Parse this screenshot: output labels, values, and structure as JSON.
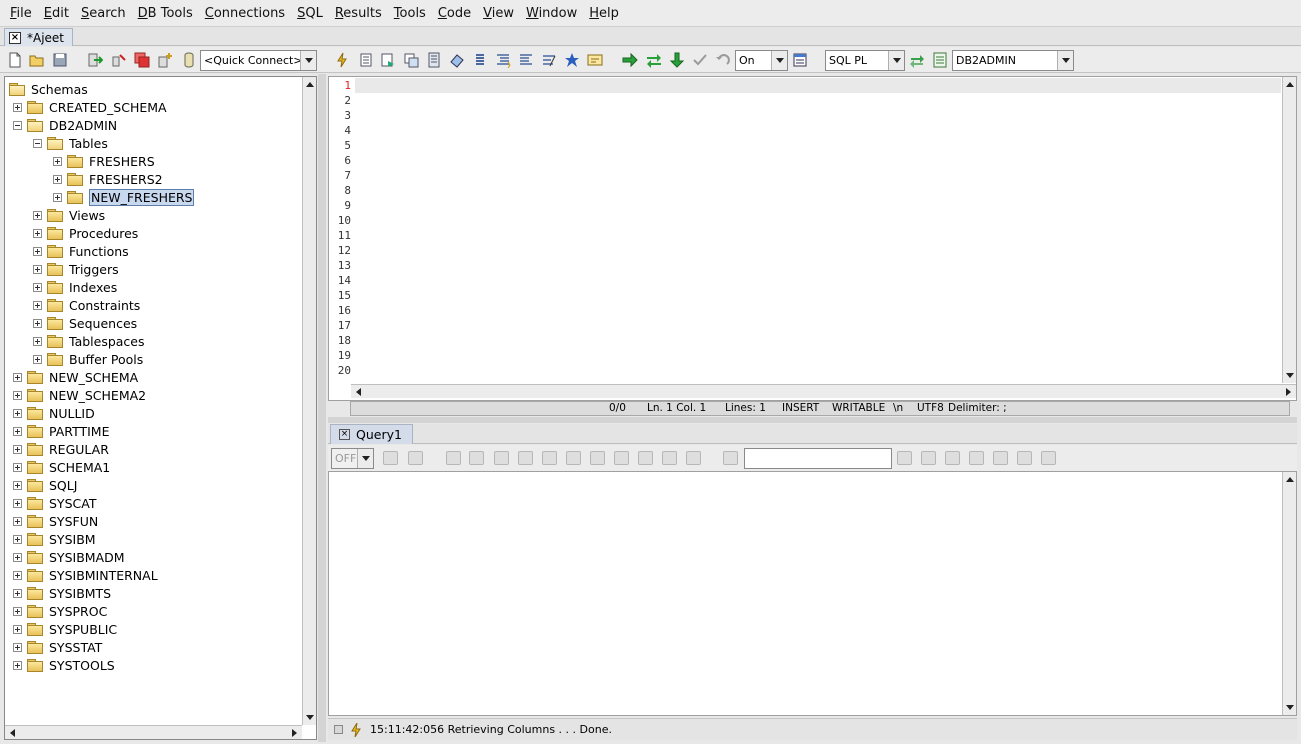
{
  "menu": [
    "File",
    "Edit",
    "Search",
    "DB Tools",
    "Connections",
    "SQL",
    "Results",
    "Tools",
    "Code",
    "View",
    "Window",
    "Help"
  ],
  "doc_tab": {
    "label": "*Ajeet"
  },
  "toolbar": {
    "quick_connect": "<Quick Connect>",
    "autocommit": "On",
    "language": "SQL PL",
    "schema": "DB2ADMIN"
  },
  "tree": {
    "root": "Schemas",
    "items": [
      {
        "label": "CREATED_SCHEMA",
        "level": 1,
        "state": "collapsed"
      },
      {
        "label": "DB2ADMIN",
        "level": 1,
        "state": "expanded"
      },
      {
        "label": "Tables",
        "level": 2,
        "state": "expanded"
      },
      {
        "label": "FRESHERS",
        "level": 3,
        "state": "collapsed"
      },
      {
        "label": "FRESHERS2",
        "level": 3,
        "state": "collapsed"
      },
      {
        "label": "NEW_FRESHERS",
        "level": 3,
        "state": "collapsed",
        "selected": true
      },
      {
        "label": "Views",
        "level": 2,
        "state": "collapsed"
      },
      {
        "label": "Procedures",
        "level": 2,
        "state": "collapsed"
      },
      {
        "label": "Functions",
        "level": 2,
        "state": "collapsed"
      },
      {
        "label": "Triggers",
        "level": 2,
        "state": "collapsed"
      },
      {
        "label": "Indexes",
        "level": 2,
        "state": "collapsed"
      },
      {
        "label": "Constraints",
        "level": 2,
        "state": "collapsed"
      },
      {
        "label": "Sequences",
        "level": 2,
        "state": "collapsed"
      },
      {
        "label": "Tablespaces",
        "level": 2,
        "state": "collapsed"
      },
      {
        "label": "Buffer Pools",
        "level": 2,
        "state": "collapsed"
      },
      {
        "label": "NEW_SCHEMA",
        "level": 1,
        "state": "collapsed"
      },
      {
        "label": "NEW_SCHEMA2",
        "level": 1,
        "state": "collapsed"
      },
      {
        "label": "NULLID",
        "level": 1,
        "state": "collapsed"
      },
      {
        "label": "PARTTIME",
        "level": 1,
        "state": "collapsed"
      },
      {
        "label": "REGULAR",
        "level": 1,
        "state": "collapsed"
      },
      {
        "label": "SCHEMA1",
        "level": 1,
        "state": "collapsed"
      },
      {
        "label": "SQLJ",
        "level": 1,
        "state": "collapsed"
      },
      {
        "label": "SYSCAT",
        "level": 1,
        "state": "collapsed"
      },
      {
        "label": "SYSFUN",
        "level": 1,
        "state": "collapsed"
      },
      {
        "label": "SYSIBM",
        "level": 1,
        "state": "collapsed"
      },
      {
        "label": "SYSIBMADM",
        "level": 1,
        "state": "collapsed"
      },
      {
        "label": "SYSIBMINTERNAL",
        "level": 1,
        "state": "collapsed"
      },
      {
        "label": "SYSIBMTS",
        "level": 1,
        "state": "collapsed"
      },
      {
        "label": "SYSPROC",
        "level": 1,
        "state": "collapsed"
      },
      {
        "label": "SYSPUBLIC",
        "level": 1,
        "state": "collapsed"
      },
      {
        "label": "SYSSTAT",
        "level": 1,
        "state": "collapsed"
      },
      {
        "label": "SYSTOOLS",
        "level": 1,
        "state": "collapsed"
      }
    ]
  },
  "editor": {
    "line_numbers": [
      "1",
      "2",
      "3",
      "4",
      "5",
      "6",
      "7",
      "8",
      "9",
      "10",
      "11",
      "12",
      "13",
      "14",
      "15",
      "16",
      "17",
      "18",
      "19",
      "20"
    ],
    "status": {
      "selection": "0/0",
      "position": "Ln. 1 Col. 1",
      "lines": "Lines: 1",
      "mode": "INSERT",
      "access": "WRITABLE",
      "newline": "\\n",
      "encoding": "UTF8",
      "delimiter": "Delimiter: ;"
    }
  },
  "query": {
    "tab_label": "Query1",
    "limit_select": "OFF",
    "filter_value": ""
  },
  "bottom_status": "15:11:42:056 Retrieving Columns . . . Done."
}
